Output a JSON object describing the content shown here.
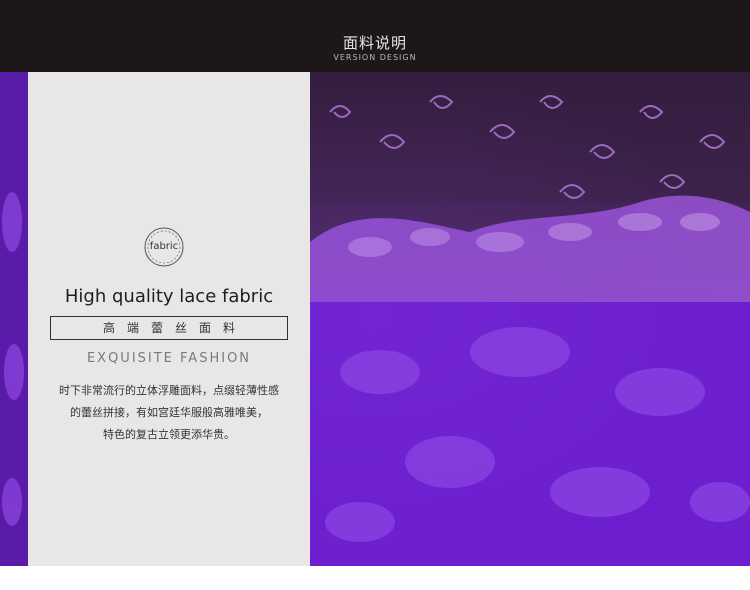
{
  "header": {
    "title_cn": "面料说明",
    "title_en": "VERSION DESIGN"
  },
  "panel": {
    "badge_label": "fabric",
    "headline": "High quality lace fabric",
    "subtitle_cn": "高端蕾丝面料",
    "tagline": "EXQUISITE FASHION",
    "description": [
      "时下非常流行的立体浮雕面料，点缀轻薄性感",
      "的蕾丝拼接，有如宫廷华服般高雅唯美，",
      "特色的复古立领更添华贵。"
    ]
  },
  "colors": {
    "header_bg": "#1e171a",
    "panel_bg": "#e9e7e5",
    "fabric_purple": "#7323d6",
    "mesh_dark": "#3a2248"
  }
}
